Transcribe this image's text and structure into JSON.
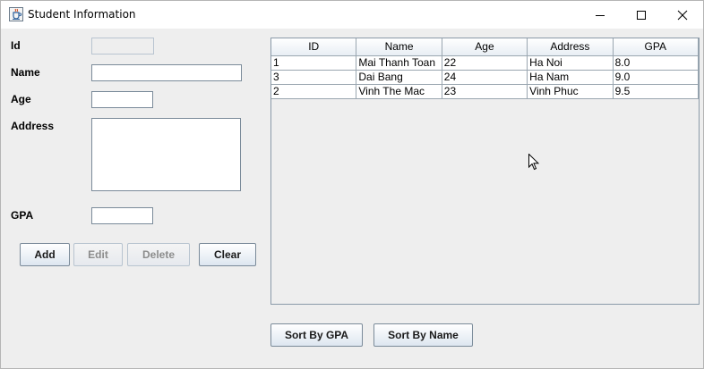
{
  "window": {
    "title": "Student Information"
  },
  "form": {
    "id_label": "Id",
    "name_label": "Name",
    "age_label": "Age",
    "address_label": "Address",
    "gpa_label": "GPA",
    "id_value": "",
    "name_value": "",
    "age_value": "",
    "address_value": "",
    "gpa_value": ""
  },
  "buttons": {
    "add": "Add",
    "edit": "Edit",
    "delete": "Delete",
    "clear": "Clear",
    "sort_gpa": "Sort By GPA",
    "sort_name": "Sort By Name"
  },
  "table": {
    "headers": [
      "ID",
      "Name",
      "Age",
      "Address",
      "GPA"
    ],
    "rows": [
      [
        "1",
        "Mai Thanh Toan",
        "22",
        "Ha Noi",
        "8.0"
      ],
      [
        "3",
        "Dai Bang",
        "24",
        "Ha Nam",
        "9.0"
      ],
      [
        "2",
        "Vinh The Mac",
        "23",
        "Vinh Phuc",
        "9.5"
      ]
    ]
  },
  "icons": {
    "app": "java-cup-icon",
    "minimize": "minimize-icon",
    "maximize": "maximize-icon",
    "close": "close-icon",
    "cursor": "mouse-pointer-icon"
  }
}
